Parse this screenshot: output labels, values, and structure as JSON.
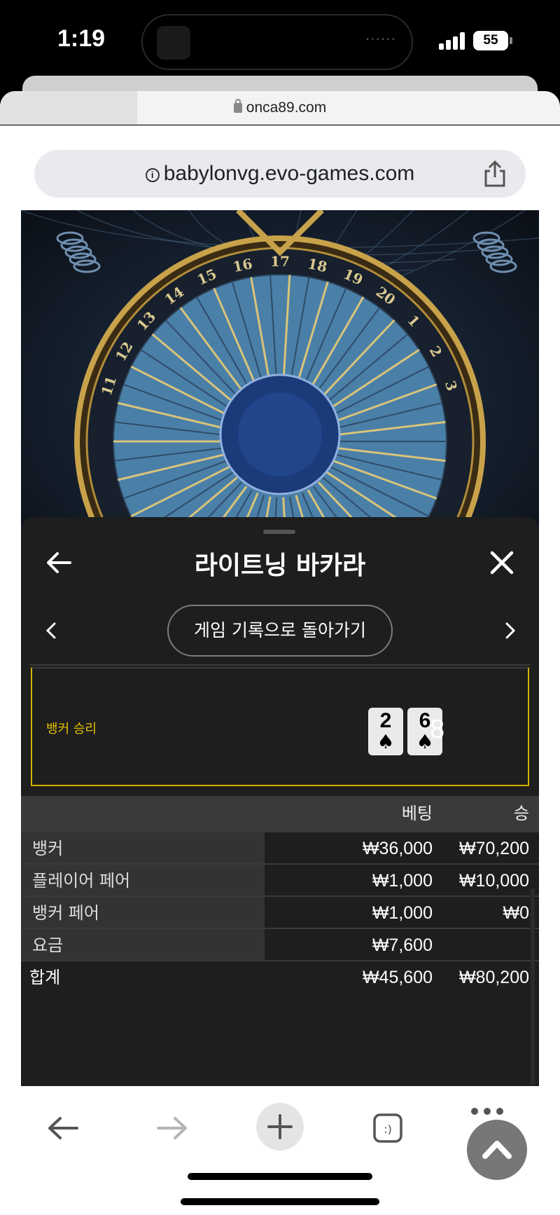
{
  "status_bar": {
    "time": "1:19",
    "battery": "55"
  },
  "browser": {
    "outer_url": "onca89.com",
    "inner_url": "babylonvg.evo-games.com"
  },
  "wheel": {
    "numbers": [
      "11",
      "12",
      "13",
      "14",
      "15",
      "16",
      "17",
      "18",
      "19",
      "20",
      "1",
      "2",
      "3"
    ]
  },
  "panel": {
    "title": "라이트닝 바카라",
    "history_button_label": "게임 기록으로 돌아가기",
    "result": {
      "label": "뱅커 승리",
      "cards": [
        {
          "rank": "2",
          "suit": "♠"
        },
        {
          "rank": "6",
          "suit": "♠"
        }
      ],
      "score": "8"
    },
    "table": {
      "headers": {
        "bet": "베팅",
        "win": "승"
      },
      "rows": [
        {
          "label": "뱅커",
          "bet": "₩36,000",
          "win": "₩70,200"
        },
        {
          "label": "플레이어 페어",
          "bet": "₩1,000",
          "win": "₩10,000"
        },
        {
          "label": "뱅커 페어",
          "bet": "₩1,000",
          "win": "₩0"
        },
        {
          "label": "요금",
          "bet": "₩7,600",
          "win": ""
        }
      ],
      "total": {
        "label": "합계",
        "bet": "₩45,600",
        "win": "₩80,200"
      }
    }
  },
  "colors": {
    "accent_gold": "#e5c100",
    "panel_bg": "#1e1e1e",
    "wheel_blue": "#4a7fa8"
  }
}
